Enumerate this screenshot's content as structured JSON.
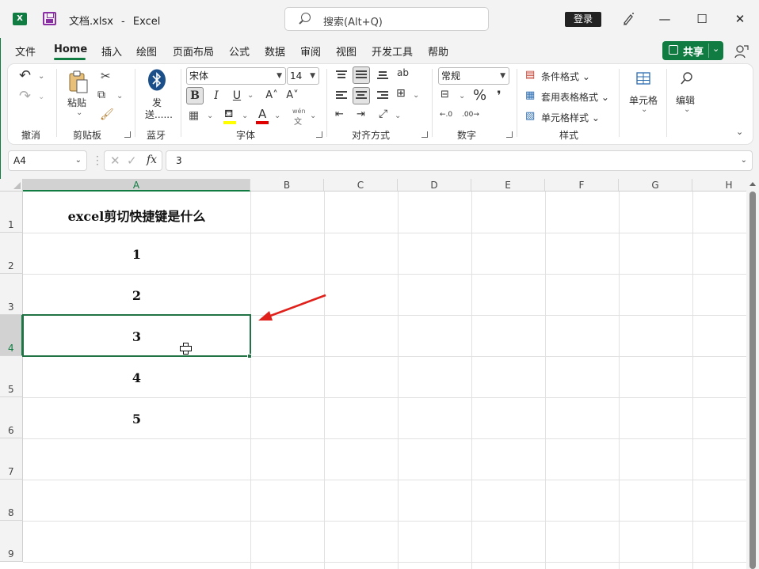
{
  "titlebar": {
    "app_icon": "X",
    "file_name": "文档.xlsx",
    "separator": "-",
    "app_name": "Excel",
    "search_placeholder": "搜索(Alt+Q)",
    "login_label": "登录",
    "minimize": "—",
    "maximize": "☐",
    "close": "✕"
  },
  "menu": {
    "items": [
      "文件",
      "Home",
      "插入",
      "绘图",
      "页面布局",
      "公式",
      "数据",
      "审阅",
      "视图",
      "开发工具",
      "帮助"
    ],
    "active": "Home",
    "share_label": "共享",
    "share_chevron": "⌄"
  },
  "ribbon": {
    "undo_icon": "↶",
    "redo_icon": "↷",
    "undo_group": "撤消",
    "paste_label": "粘贴",
    "clipboard_group": "剪贴板",
    "send_label_1": "发",
    "send_label_2": "送......",
    "bluetooth_group": "蓝牙",
    "font_name": "宋体",
    "font_size": "14",
    "bold": "B",
    "italic": "I",
    "underline": "U",
    "grow_font": "A˄",
    "shrink_font": "A˅",
    "font_color_letter": "A",
    "phonetic_top": "wén",
    "phonetic_bottom": "文",
    "font_group": "字体",
    "wrap_icon": "ab",
    "align_group": "对齐方式",
    "number_format": "常规",
    "percent": "%",
    "comma": "❜",
    "dec_inc": "←.0",
    "dec_dec": ".00→",
    "number_group": "数字",
    "cond_format": "条件格式",
    "table_format": "套用表格格式",
    "cell_style": "单元格样式",
    "styles_group": "样式",
    "cells_label": "单元格",
    "edit_label": "编辑",
    "colors": {
      "highlight": "#ffff00",
      "font_color": "#e00000",
      "accent": "#107c41"
    }
  },
  "formula_bar": {
    "name_box": "A4",
    "cancel_icon": "✕",
    "enter_icon": "✓",
    "fx_label": "fx",
    "formula_value": "3"
  },
  "sheet": {
    "columns": [
      "A",
      "B",
      "C",
      "D",
      "E",
      "F",
      "G",
      "H"
    ],
    "rows": [
      "1",
      "2",
      "3",
      "4",
      "5",
      "6",
      "7",
      "8",
      "9"
    ],
    "selected_cell": "A4",
    "cells": {
      "A1": "excel剪切快捷键是什么",
      "A2": "1",
      "A3": "2",
      "A4": "3",
      "A5": "4",
      "A6": "5"
    },
    "annotation_arrow_color": "#e0201a"
  }
}
